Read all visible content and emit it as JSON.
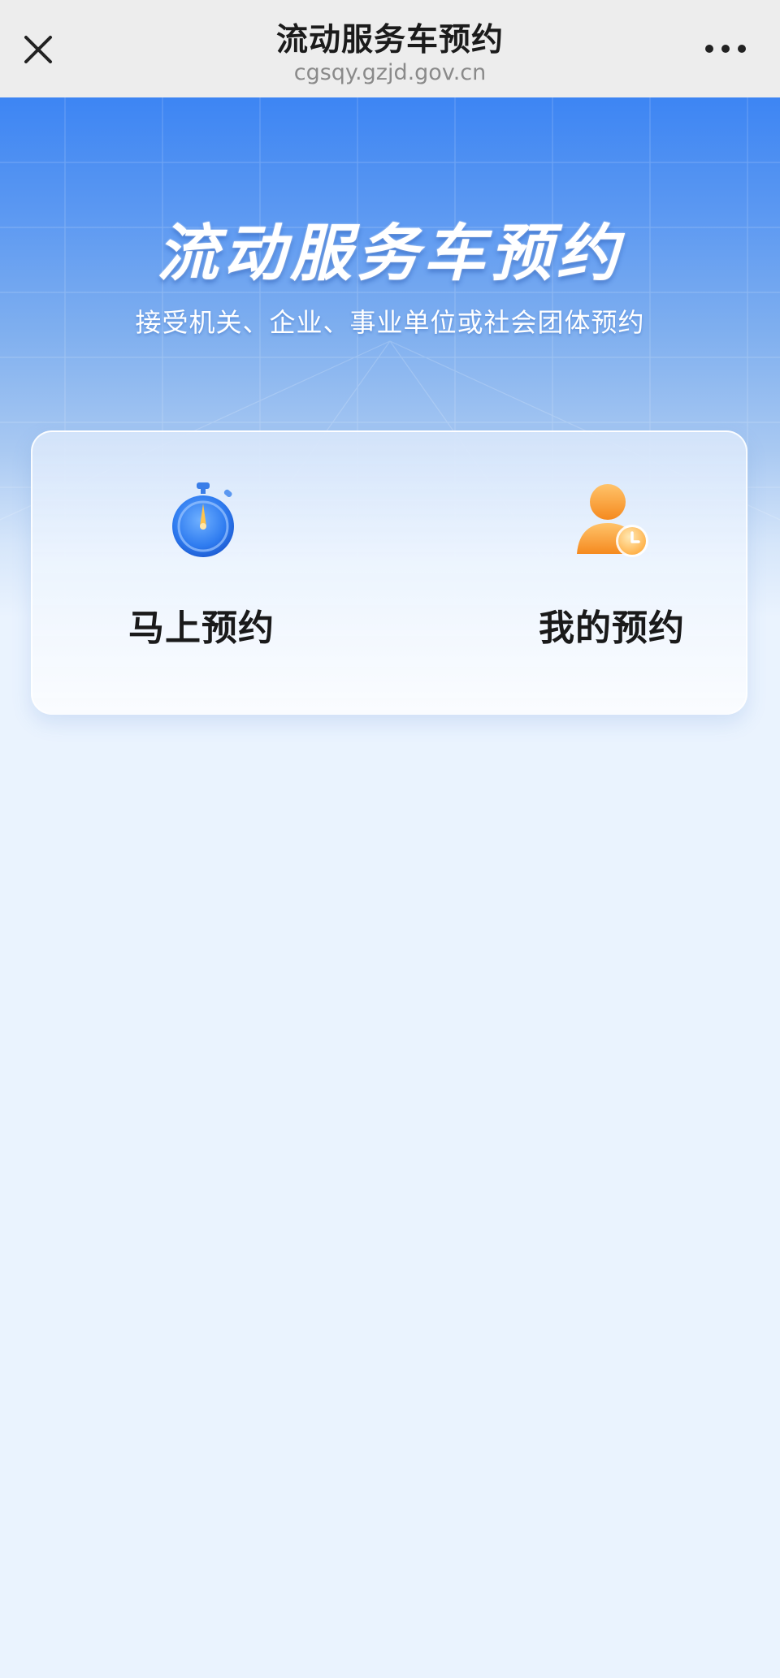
{
  "topbar": {
    "title": "流动服务车预约",
    "url": "cgsqy.gzjd.gov.cn",
    "close_icon": "close-icon",
    "more_icon": "more-icon"
  },
  "hero": {
    "title": "流动服务车预约",
    "subtitle": "接受机关、企业、事业单位或社会团体预约"
  },
  "actions": [
    {
      "label": "马上预约",
      "icon": "stopwatch-icon",
      "color": "#2f7cf0"
    },
    {
      "label": "我的预约",
      "icon": "user-clock-icon",
      "color": "#f79a2e"
    }
  ],
  "colors": {
    "brand_blue": "#3d85f3",
    "page_background": "#eaf3fe",
    "accent_orange": "#f79a2e"
  }
}
